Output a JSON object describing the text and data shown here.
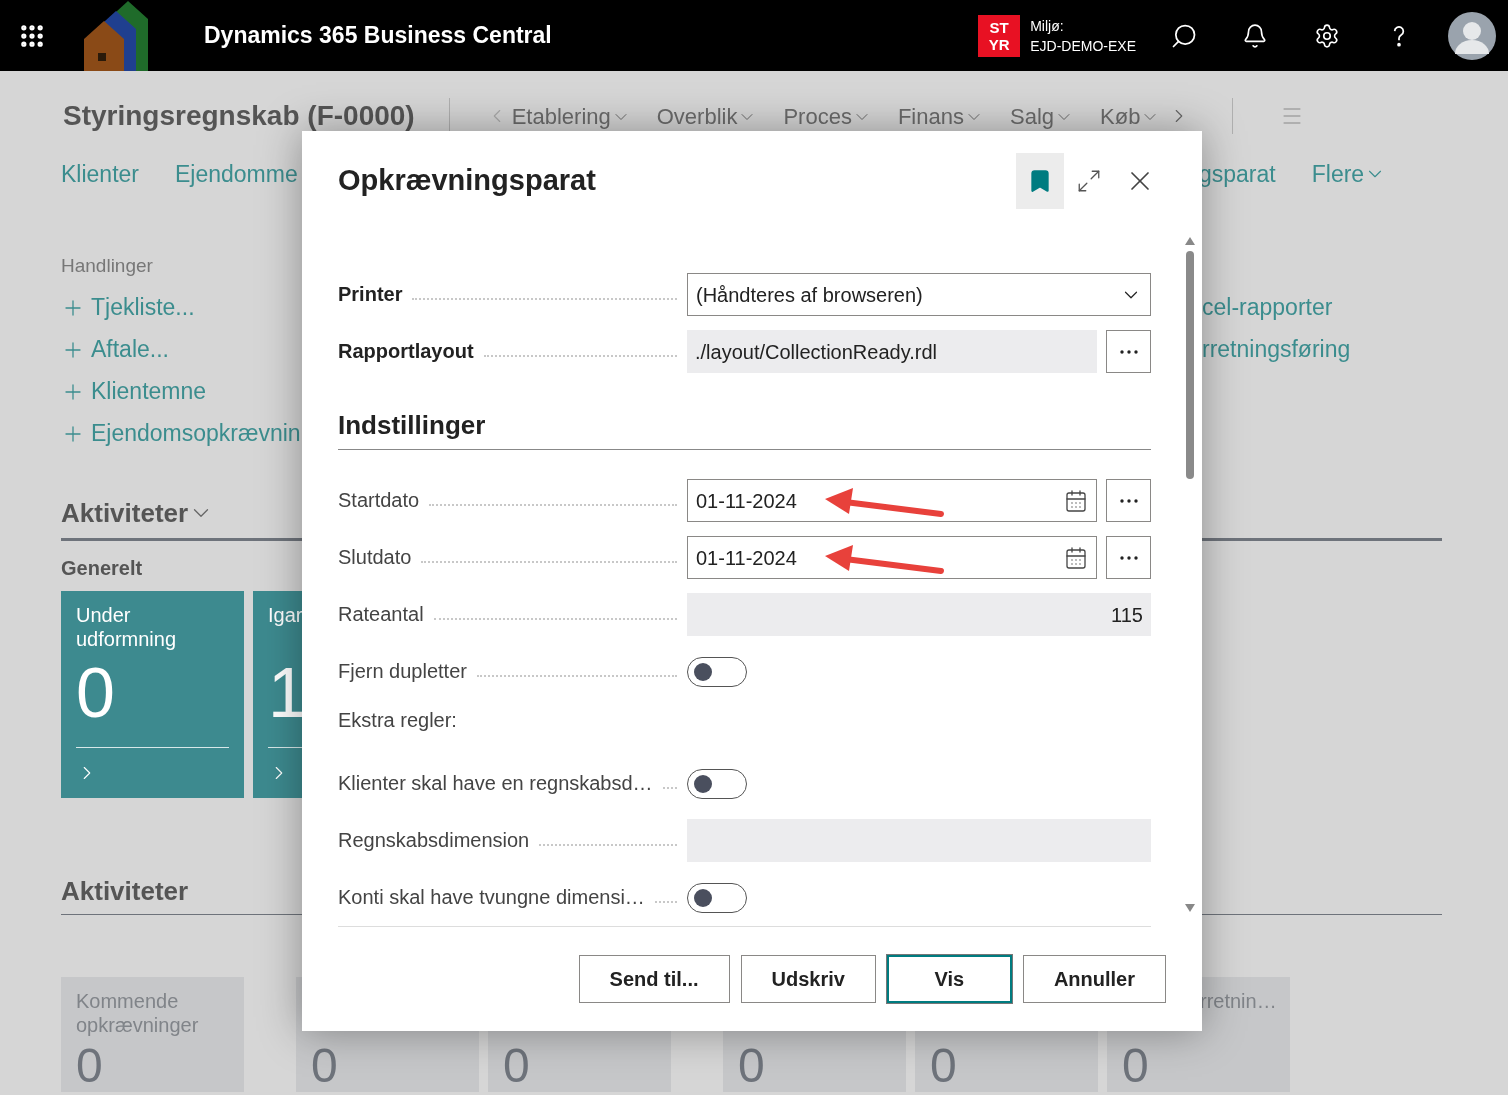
{
  "header": {
    "app_title": "Dynamics 365 Business Central",
    "environment": {
      "badge": [
        "ST",
        "YR"
      ],
      "label": "Miljø:",
      "name": "EJD-DEMO-EXE"
    }
  },
  "page": {
    "title": "Styringsregnskab (F-0000)",
    "nav": [
      "Etablering",
      "Overblik",
      "Proces",
      "Finans",
      "Salg",
      "Køb"
    ],
    "links": [
      {
        "label": "Klienter",
        "dropdown": false
      },
      {
        "label": "Ejendomme",
        "dropdown": false
      }
    ],
    "links_right": [
      {
        "label": "gsparat",
        "dropdown": false
      },
      {
        "label": "Flere",
        "dropdown": true
      }
    ],
    "actions": {
      "heading": "Handlinger",
      "items": [
        "Tjekliste...",
        "Aftale...",
        "Klientemne",
        "Ejendomsopkrævnin"
      ]
    },
    "reports": [
      "cel-rapporter",
      "rretningsføring"
    ],
    "activities": {
      "title": "Aktiviteter",
      "group": "Generelt",
      "tiles": [
        {
          "label": "Under udformning",
          "value": "0"
        },
        {
          "label": "Igar",
          "value": "1"
        }
      ]
    },
    "activities_2": {
      "title": "Aktiviteter",
      "tiles": [
        {
          "lines": [
            "Kommende",
            "opkrævninger"
          ],
          "value": "0"
        },
        {
          "value": "0"
        },
        {
          "value": "0"
        },
        {
          "value": "0"
        },
        {
          "value": "0"
        },
        {
          "lines": [
            "rretnin…"
          ],
          "value": "0"
        }
      ]
    }
  },
  "dialog": {
    "title": "Opkrævningsparat",
    "fields": [
      {
        "kind": "select",
        "label": "Printer",
        "value": "(Håndteres af browseren)"
      },
      {
        "kind": "lookup",
        "label": "Rapportlayout",
        "value": "./layout/CollectionReady.rdl"
      }
    ],
    "settings": {
      "title": "Indstillinger",
      "fields": [
        {
          "kind": "date",
          "label": "Startdato",
          "value": "01-11-2024",
          "annotated": true
        },
        {
          "kind": "date",
          "label": "Slutdato",
          "value": "01-11-2024",
          "annotated": true
        },
        {
          "kind": "readonly",
          "label": "Rateantal",
          "value": "115"
        },
        {
          "kind": "toggle",
          "label": "Fjern dupletter",
          "on": false
        },
        {
          "kind": "caption",
          "label": "Ekstra regler:"
        },
        {
          "kind": "toggle",
          "label": "Klienter skal have en regnskabsd…",
          "on": false
        },
        {
          "kind": "readonly",
          "label": "Regnskabsdimension"
        },
        {
          "kind": "toggle",
          "label": "Konti skal have tvungne dimensi…",
          "on": false
        }
      ]
    },
    "buttons": [
      {
        "label": "Send til...",
        "selected": false
      },
      {
        "label": "Udskriv",
        "selected": false
      },
      {
        "label": "Vis",
        "selected": true
      },
      {
        "label": "Annuller",
        "selected": false
      }
    ]
  }
}
